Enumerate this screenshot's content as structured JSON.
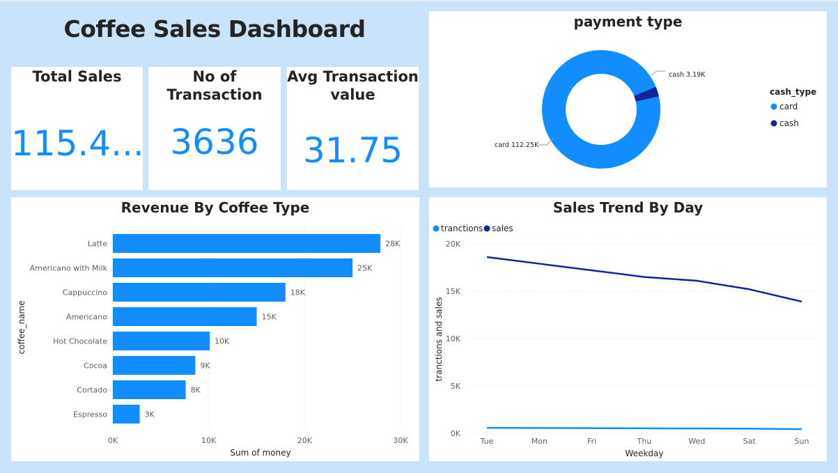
{
  "dashboard": {
    "title": "Coffee Sales Dashboard"
  },
  "kpis": [
    {
      "label": "Total Sales",
      "value": "115.4..."
    },
    {
      "label": "No of Transaction",
      "value": "3636"
    },
    {
      "label": "Avg Transaction",
      "label2": "value",
      "value": "31.75"
    }
  ],
  "payment": {
    "title": "payment type",
    "legend_title": "cash_type",
    "legend": [
      {
        "name": "card",
        "color": "#118dff"
      },
      {
        "name": "cash",
        "color": "#12239e"
      }
    ],
    "slice_labels": {
      "card": "card 112.25K",
      "cash": "cash 3.19K"
    },
    "chart_data": {
      "type": "pie",
      "categories": [
        "card",
        "cash"
      ],
      "values": [
        112.25,
        3.19
      ],
      "unit": "K",
      "title": "payment type",
      "legend_title": "cash_type",
      "legend_position": "right"
    }
  },
  "revenue": {
    "title": "Revenue By Coffee Type",
    "xlabel": "Sum of money",
    "ylabel": "coffee_name",
    "x_ticks": [
      "0K",
      "10K",
      "20K",
      "30K"
    ],
    "value_labels": [
      "28K",
      "25K",
      "18K",
      "15K",
      "10K",
      "9K",
      "8K",
      "3K"
    ],
    "chart_data": {
      "type": "bar",
      "orientation": "horizontal",
      "categories": [
        "Latte",
        "Americano with Milk",
        "Cappuccino",
        "Americano",
        "Hot Chocolate",
        "Cocoa",
        "Cortado",
        "Espresso"
      ],
      "values": [
        27900,
        25000,
        18000,
        15000,
        10100,
        8600,
        7600,
        2800
      ],
      "xlim": [
        0,
        30000
      ],
      "title": "Revenue By Coffee Type",
      "xlabel": "Sum of money",
      "ylabel": "coffee_name",
      "grid": true
    }
  },
  "trend": {
    "title": "Sales Trend By Day",
    "xlabel": "Weekday",
    "ylabel": "tranctions and sales",
    "y_ticks": [
      "0K",
      "5K",
      "10K",
      "15K",
      "20K"
    ],
    "chart_data": {
      "type": "line",
      "categories": [
        "Tue",
        "Mon",
        "Fri",
        "Thu",
        "Wed",
        "Sat",
        "Sun"
      ],
      "series": [
        {
          "name": "tranctions",
          "color": "#118dff",
          "values": [
            580,
            560,
            540,
            520,
            510,
            490,
            440
          ]
        },
        {
          "name": "sales",
          "color": "#12239e",
          "values": [
            18600,
            17900,
            17200,
            16500,
            16100,
            15200,
            13900
          ]
        }
      ],
      "ylim": [
        0,
        20000
      ],
      "title": "Sales Trend By Day",
      "xlabel": "Weekday",
      "ylabel": "tranctions and sales",
      "legend_position": "top-left",
      "grid": true
    }
  }
}
